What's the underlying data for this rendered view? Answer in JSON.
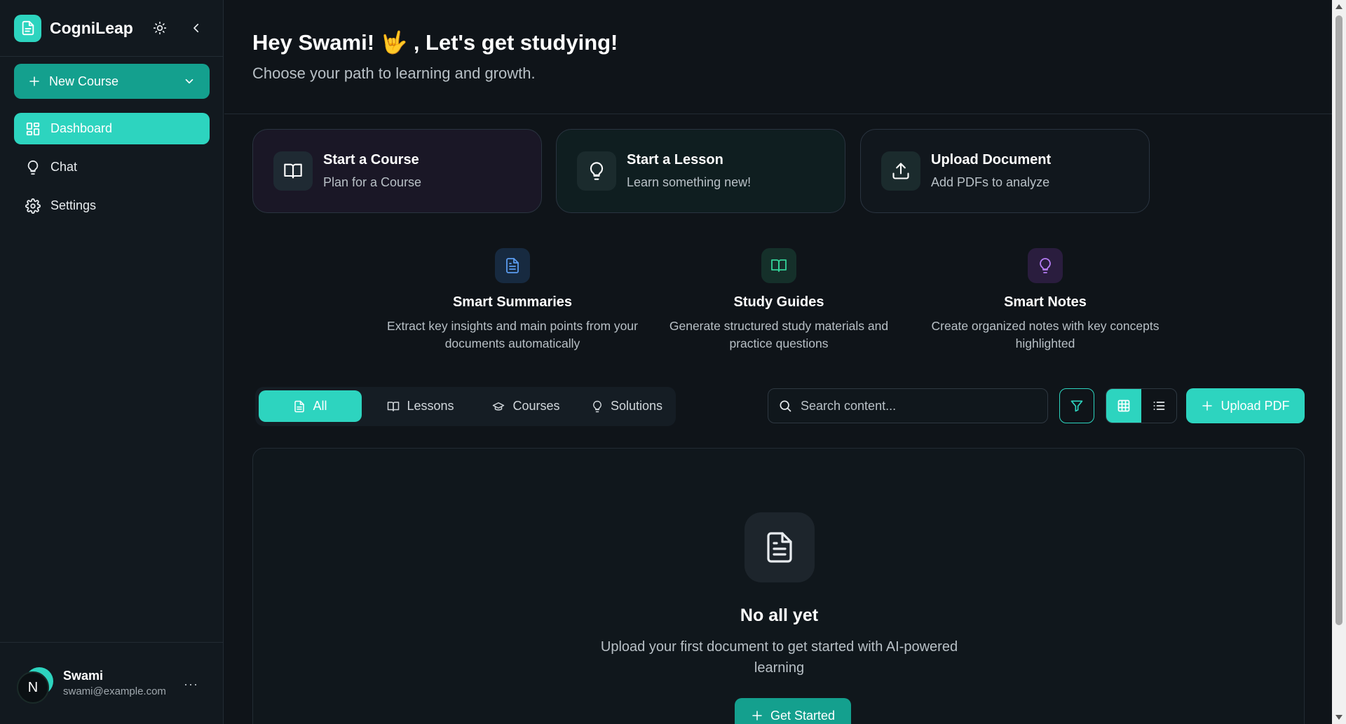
{
  "app": {
    "name": "CogniLeap"
  },
  "sidebar": {
    "new_course_label": "New Course",
    "items": [
      {
        "label": "Dashboard",
        "icon": "dashboard-icon",
        "active": true
      },
      {
        "label": "Chat",
        "icon": "lightbulb-icon",
        "active": false
      },
      {
        "label": "Settings",
        "icon": "gear-icon",
        "active": false
      }
    ],
    "user": {
      "initial": "N",
      "name": "Swami",
      "email": "swami@example.com",
      "more": "···"
    }
  },
  "header": {
    "greeting": "Hey Swami! 🤟 , Let's get studying!",
    "subtitle": "Choose your path to learning and growth."
  },
  "actions": [
    {
      "title": "Start a Course",
      "subtitle": "Plan for a Course",
      "icon": "book-open-icon"
    },
    {
      "title": "Start a Lesson",
      "subtitle": "Learn something new!",
      "icon": "lightbulb-icon"
    },
    {
      "title": "Upload Document",
      "subtitle": "Add PDFs to analyze",
      "icon": "upload-icon"
    }
  ],
  "features": [
    {
      "title": "Smart Summaries",
      "description": "Extract key insights and main points from your documents automatically",
      "icon": "document-icon"
    },
    {
      "title": "Study Guides",
      "description": "Generate structured study materials and practice questions",
      "icon": "book-open-icon"
    },
    {
      "title": "Smart Notes",
      "description": "Create organized notes with key concepts highlighted",
      "icon": "lightbulb-icon"
    }
  ],
  "filters": {
    "tabs": [
      {
        "label": "All",
        "active": true
      },
      {
        "label": "Lessons",
        "active": false
      },
      {
        "label": "Courses",
        "active": false
      },
      {
        "label": "Solutions",
        "active": false
      }
    ],
    "search_placeholder": "Search content...",
    "upload_label": "Upload PDF",
    "view_mode": "grid"
  },
  "empty_state": {
    "title": "No all yet",
    "description": "Upload your first document to get started with AI-powered learning",
    "button_label": "Get Started"
  },
  "colors": {
    "accent": "#2dd4bf",
    "accent_dark": "#14a08e",
    "background": "#0f1419",
    "sidebar": "#12191f"
  }
}
